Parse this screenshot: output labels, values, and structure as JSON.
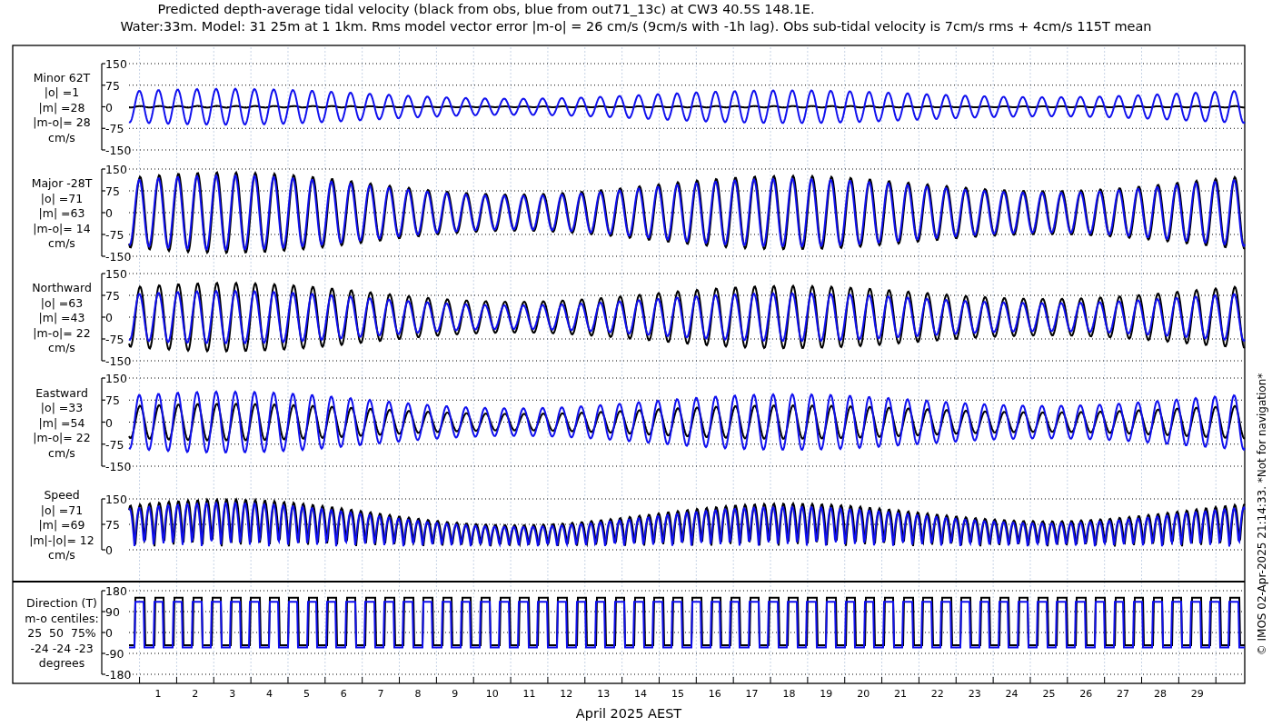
{
  "title_lines": [
    "Predicted depth-average tidal velocity (black from obs, blue from out71_13c) at CW3 40.5S 148.1E.",
    "Water:33m. Model: 31 25m at 1 1km. Rms model vector error |m-o| = 26 cm/s (9cm/s with -1h lag). Obs sub-tidal velocity is 7cm/s rms + 4cm/s 115T mean"
  ],
  "panels": [
    {
      "kind": "vector",
      "label_lines": [
        "Minor 62T",
        "|o| =1",
        "|m| =28",
        "|m-o|= 28",
        "cm/s"
      ],
      "yticks": [
        "150",
        "75",
        "0",
        "-75",
        "-150"
      ]
    },
    {
      "kind": "vector",
      "label_lines": [
        "Major -28T",
        "|o| =71",
        "|m| =63",
        "|m-o|= 14",
        "cm/s"
      ],
      "yticks": [
        "150",
        "75",
        "0",
        "-75",
        "-150"
      ]
    },
    {
      "kind": "vector",
      "label_lines": [
        "Northward",
        "|o| =63",
        "|m| =43",
        "|m-o|= 22",
        "cm/s"
      ],
      "yticks": [
        "150",
        "75",
        "0",
        "-75",
        "-150"
      ]
    },
    {
      "kind": "vector",
      "label_lines": [
        "Eastward",
        "|o| =33",
        "|m| =54",
        "|m-o|= 22",
        "cm/s"
      ],
      "yticks": [
        "150",
        "75",
        "0",
        "-75",
        "-150"
      ]
    },
    {
      "kind": "speed",
      "label_lines": [
        "Speed",
        "|o| =71",
        "|m| =69",
        "|m|-|o|= 12",
        "cm/s"
      ],
      "yticks": [
        "150",
        "75",
        "0"
      ]
    },
    {
      "kind": "direction",
      "label_lines": [
        "Direction (T)",
        "m-o centiles:",
        "25  50  75%",
        "-24 -24 -23",
        "degrees"
      ],
      "yticks": [
        "180",
        "90",
        "0",
        "-90",
        "-180"
      ]
    }
  ],
  "xticks": [
    "1",
    "2",
    "3",
    "4",
    "5",
    "6",
    "7",
    "8",
    "9",
    "10",
    "11",
    "12",
    "13",
    "14",
    "15",
    "16",
    "17",
    "18",
    "19",
    "20",
    "21",
    "22",
    "23",
    "24",
    "25",
    "26",
    "27",
    "28",
    "29"
  ],
  "xlabel": "April 2025 AEST",
  "credit": "© IMOS 02-Apr-2025 21:14:33. *Not for navigation*"
}
